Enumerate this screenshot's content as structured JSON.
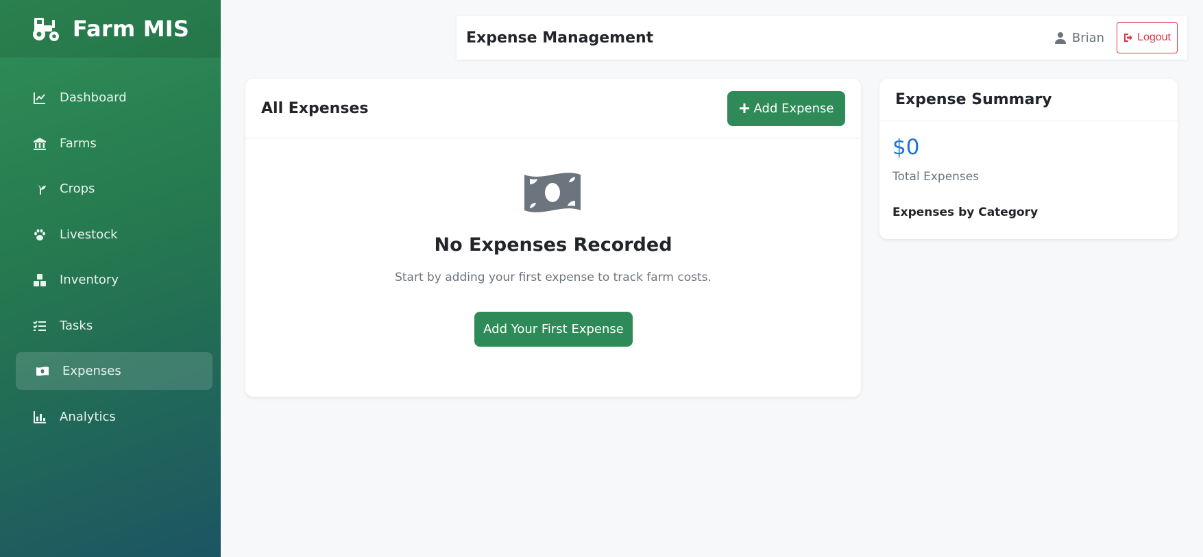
{
  "brand": {
    "name": "Farm MIS",
    "icon": "tractor-icon"
  },
  "sidebar": {
    "items": [
      {
        "label": "Dashboard",
        "icon": "chart-line-icon",
        "active": false
      },
      {
        "label": "Farms",
        "icon": "building-icon",
        "active": false
      },
      {
        "label": "Crops",
        "icon": "seedling-icon",
        "active": false
      },
      {
        "label": "Livestock",
        "icon": "paw-icon",
        "active": false
      },
      {
        "label": "Inventory",
        "icon": "boxes-icon",
        "active": false
      },
      {
        "label": "Tasks",
        "icon": "tasks-icon",
        "active": false
      },
      {
        "label": "Expenses",
        "icon": "money-bill-icon",
        "active": true
      },
      {
        "label": "Analytics",
        "icon": "chart-bar-icon",
        "active": false
      }
    ]
  },
  "header": {
    "title": "Expense Management",
    "user": "Brian",
    "logout": "Logout"
  },
  "expenses": {
    "title": "All Expenses",
    "add_button": "Add Expense",
    "empty_title": "No Expenses Recorded",
    "empty_text": "Start by adding your first expense to track farm costs.",
    "first_button": "Add Your First Expense"
  },
  "summary": {
    "title": "Expense Summary",
    "total": "$0",
    "total_label": "Total Expenses",
    "by_category": "Expenses by Category"
  },
  "colors": {
    "primary": "#2e8b57",
    "accent": "#1a73d9",
    "danger": "#dc3545"
  }
}
